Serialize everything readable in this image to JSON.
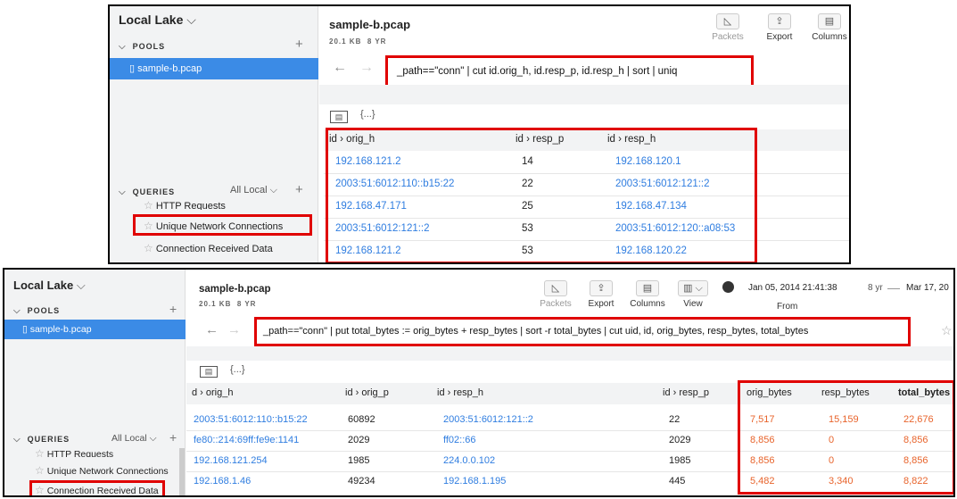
{
  "top": {
    "sidebar": {
      "lake_title": "Local Lake",
      "pools_label": "POOLS",
      "pool_item": "sample-b.pcap",
      "queries_label": "QUERIES",
      "queries_filter": "All Local",
      "query_items": [
        "HTTP Requests",
        "Unique Network Connections",
        "Connection Received Data"
      ]
    },
    "header": {
      "title": "sample-b.pcap",
      "size": "20.1 KB",
      "age": "8 YR",
      "buttons": [
        "Packets",
        "Export",
        "Columns"
      ]
    },
    "query": "_path==\"conn\" | cut id.orig_h, id.resp_p, id.resp_h | sort | uniq",
    "view_toggle": "{...}",
    "columns": [
      "id › orig_h",
      "id › resp_p",
      "id › resp_h"
    ],
    "rows": [
      [
        "192.168.121.2",
        "14",
        "192.168.120.1"
      ],
      [
        "2003:51:6012:110::b15:22",
        "22",
        "2003:51:6012:121::2"
      ],
      [
        "192.168.47.171",
        "25",
        "192.168.47.134"
      ],
      [
        "2003:51:6012:121::2",
        "53",
        "2003:51:6012:120::a08:53"
      ],
      [
        "192.168.121.2",
        "53",
        "192.168.120.22"
      ]
    ]
  },
  "bottom": {
    "sidebar": {
      "lake_title": "Local Lake",
      "pools_label": "POOLS",
      "pool_item": "sample-b.pcap",
      "queries_label": "QUERIES",
      "queries_filter": "All Local",
      "query_items": [
        "HTTP Requests",
        "Unique Network Connections",
        "Connection Received Data"
      ]
    },
    "header": {
      "title": "sample-b.pcap",
      "size": "20.1 KB",
      "age": "8 YR",
      "buttons": [
        "Packets",
        "Export",
        "Columns",
        "View"
      ],
      "from_date": "Jan 05, 2014 21:41:38",
      "span": "8 yr",
      "to_date": "Mar 17, 20",
      "from_label": "From"
    },
    "query": "_path==\"conn\" | put total_bytes := orig_bytes + resp_bytes | sort -r total_bytes | cut uid, id, orig_bytes, resp_bytes, total_bytes",
    "view_toggle": "{...}",
    "columns": [
      "d › orig_h",
      "id › orig_p",
      "id › resp_h",
      "id › resp_p",
      "orig_bytes",
      "resp_bytes",
      "total_bytes"
    ],
    "rows": [
      [
        "2003:51:6012:110::b15:22",
        "60892",
        "2003:51:6012:121::2",
        "22",
        "7,517",
        "15,159",
        "22,676"
      ],
      [
        "fe80::214:69ff:fe9e:1141",
        "2029",
        "ff02::66",
        "2029",
        "8,856",
        "0",
        "8,856"
      ],
      [
        "192.168.121.254",
        "1985",
        "224.0.0.102",
        "1985",
        "8,856",
        "0",
        "8,856"
      ],
      [
        "192.168.1.46",
        "49234",
        "192.168.1.195",
        "445",
        "5,482",
        "3,340",
        "8,822"
      ]
    ]
  }
}
